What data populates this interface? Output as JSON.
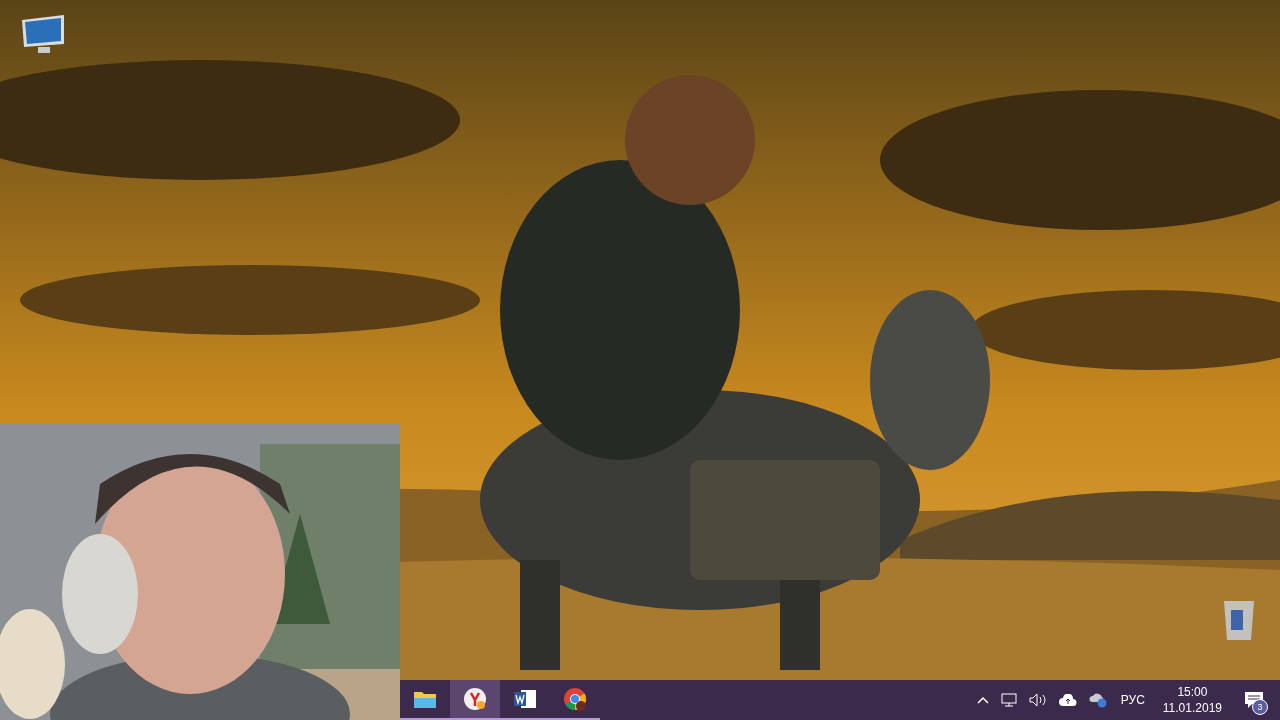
{
  "desktop": {
    "icons": [
      {
        "kind": "computer"
      },
      {
        "kind": "recycle_bin"
      }
    ]
  },
  "taskbar": {
    "apps": [
      {
        "kind": "folder",
        "selected": false
      },
      {
        "kind": "browser_y",
        "selected": true
      },
      {
        "kind": "word",
        "selected": false
      },
      {
        "kind": "chrome",
        "selected": false
      }
    ],
    "tray": {
      "language": "РУС",
      "time": "15:00",
      "date": "11.01.2019",
      "notifications": "3"
    }
  }
}
